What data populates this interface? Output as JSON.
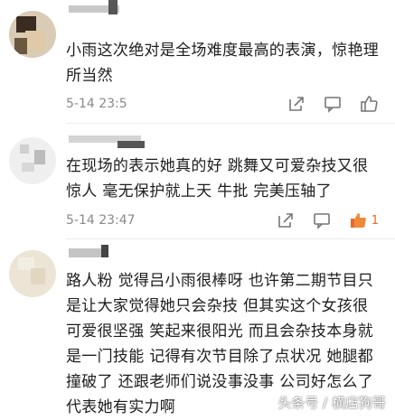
{
  "comments": [
    {
      "text": "小雨这次绝对是全场难度最高的表演，惊艳理所当然",
      "time": "5-14 23:5",
      "like_count": ""
    },
    {
      "text": "在现场的表示她真的好 跳舞又可爱杂技又很惊人 毫无保护就上天 牛批 完美压轴了",
      "time": "5-14 23:47",
      "like_count": "1"
    },
    {
      "text": "路人粉 觉得吕小雨很棒呀 也许第二期节目只是让大家觉得她只会杂技 但其实这个女孩很可爱很坚强 笑起来很阳光 而且会杂技本身就是一门技能 记得有次节目除了点状况 她腿都撞破了 还跟老师们说没事没事 公司好怎么了 代表她有实力啊",
      "time": "",
      "like_count": ""
    }
  ],
  "watermark": "头条号 / 横店狗哥",
  "colors": {
    "like_active": "#e86a2a",
    "icon": "#777777",
    "time": "#8a8a8a"
  },
  "icons": [
    "share-icon",
    "comment-icon",
    "like-icon"
  ]
}
